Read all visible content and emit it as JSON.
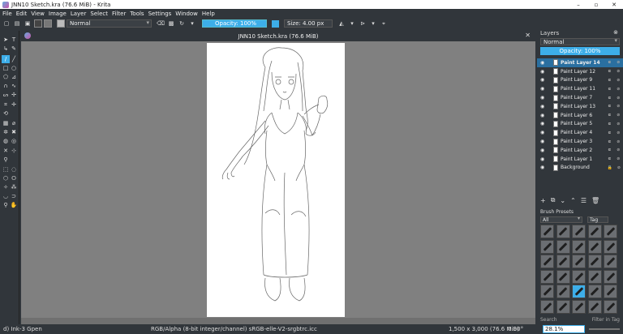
{
  "window": {
    "title": "JNN10 Sketch.kra (76.6 MiB) - Krita",
    "minimize": "–",
    "maximize": "▫",
    "close": "✕"
  },
  "menu": [
    "File",
    "Edit",
    "View",
    "Image",
    "Layer",
    "Select",
    "Filter",
    "Tools",
    "Settings",
    "Window",
    "Help"
  ],
  "toolbar": {
    "blend_mode": "Normal",
    "opacity": "Opacity: 100%",
    "size": "Size: 4.00 px",
    "accent": "#3daee9"
  },
  "document": {
    "title": "JNN10 Sketch.kra (76.6 MiB)",
    "close": "✕"
  },
  "layers_panel": {
    "title": "Layers",
    "blend_mode": "Normal",
    "opacity": "Opacity:  100%",
    "layers": [
      {
        "name": "Paint Layer 14",
        "selected": true
      },
      {
        "name": "Paint Layer 12"
      },
      {
        "name": "Paint Layer 9"
      },
      {
        "name": "Paint Layer 11"
      },
      {
        "name": "Paint Layer 7"
      },
      {
        "name": "Paint Layer 13"
      },
      {
        "name": "Paint Layer 6"
      },
      {
        "name": "Paint Layer 5"
      },
      {
        "name": "Paint Layer 4"
      },
      {
        "name": "Paint Layer 3"
      },
      {
        "name": "Paint Layer 2"
      },
      {
        "name": "Paint Layer 1"
      },
      {
        "name": "Background"
      }
    ]
  },
  "brush_presets": {
    "title": "Brush Presets",
    "filter": "All",
    "tag": "Tag",
    "search": "Search",
    "filter_in_tag": "Filter in Tag"
  },
  "status": {
    "brush": "d) Ink-3 Gpen",
    "color_space": "RGB/Alpha (8-bit integer/channel)  sRGB-elle-V2-srgbtrc.icc",
    "image_size": "1,500 x 3,000 (76.6 MiB)",
    "rotation": "0.00°",
    "zoom": "28.1%"
  }
}
